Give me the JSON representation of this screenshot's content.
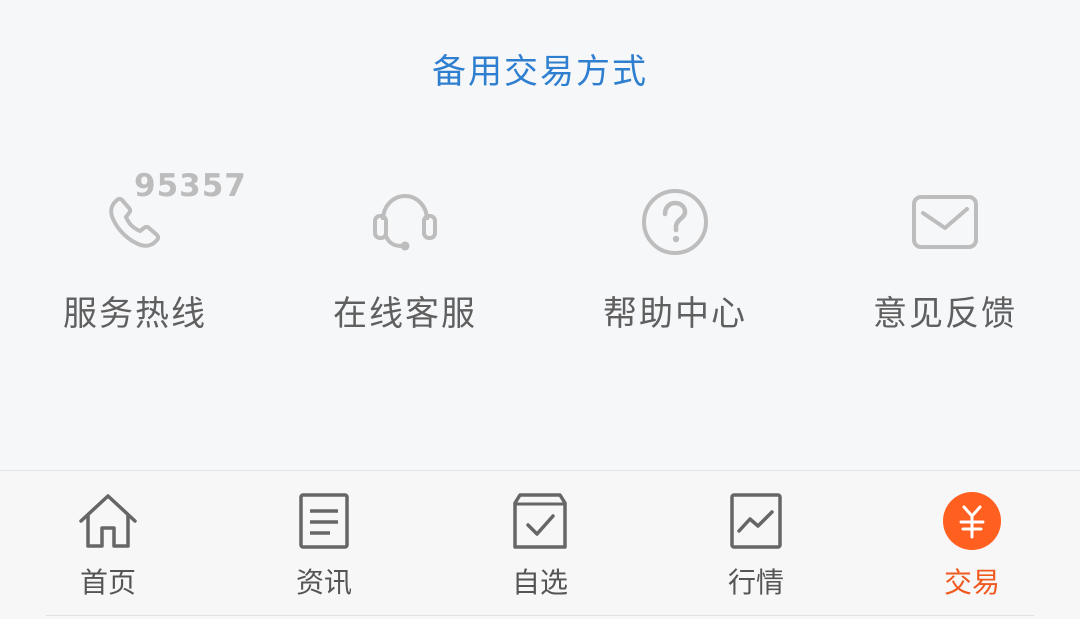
{
  "header": {
    "alternative_trading_link": "备用交易方式"
  },
  "services": [
    {
      "label": "服务热线",
      "icon": "phone-icon",
      "number": "95357"
    },
    {
      "label": "在线客服",
      "icon": "headset-icon"
    },
    {
      "label": "帮助中心",
      "icon": "question-circle-icon"
    },
    {
      "label": "意见反馈",
      "icon": "envelope-icon"
    }
  ],
  "tabbar": {
    "tabs": [
      {
        "label": "首页",
        "icon": "home-icon",
        "active": false
      },
      {
        "label": "资讯",
        "icon": "document-icon",
        "active": false
      },
      {
        "label": "自选",
        "icon": "checkbox-icon",
        "active": false
      },
      {
        "label": "行情",
        "icon": "chart-icon",
        "active": false
      },
      {
        "label": "交易",
        "icon": "yuan-icon",
        "active": true
      }
    ],
    "active_color": "#f05a1e"
  },
  "colors": {
    "link": "#2f7fd0",
    "icon_gray": "#bdbdbd",
    "label_gray": "#5f5f5f"
  }
}
